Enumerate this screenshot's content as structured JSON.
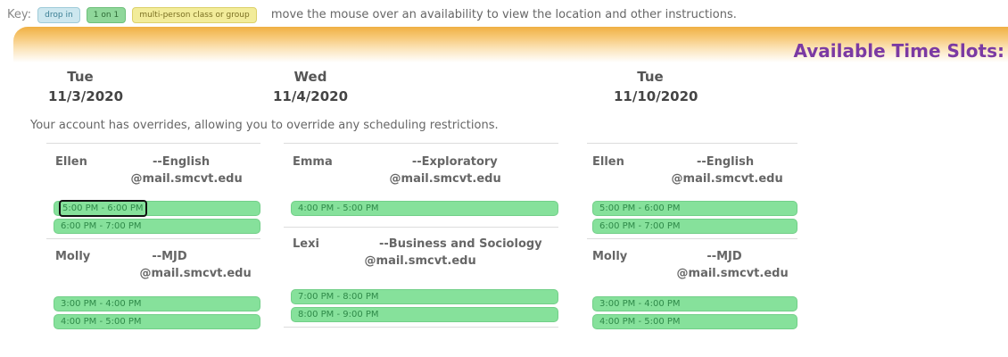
{
  "key": {
    "label": "Key:",
    "chips": [
      "drop in",
      "1 on 1",
      "multi-person class or group"
    ],
    "instruction": "move the mouse over an availability to view the location and other instructions."
  },
  "banner": {
    "title": "Available Time Slots:"
  },
  "days": [
    {
      "dow": "Tue",
      "date": "11/3/2020"
    },
    {
      "dow": "Wed",
      "date": "11/4/2020"
    },
    {
      "dow": "Tue",
      "date": "11/10/2020"
    }
  ],
  "override_notice": "Your account has overrides, allowing you to override any scheduling restrictions.",
  "columns": [
    {
      "tutors": [
        {
          "name": "Ellen",
          "subject": "--English",
          "email": "@mail.smcvt.edu",
          "slots": [
            "5:00 PM - 6:00 PM",
            "6:00 PM - 7:00 PM"
          ]
        },
        {
          "name": "Molly",
          "subject": "--MJD",
          "email": "@mail.smcvt.edu",
          "slots": [
            "3:00 PM - 4:00 PM",
            "4:00 PM - 5:00 PM"
          ]
        }
      ]
    },
    {
      "tutors": [
        {
          "name": "Emma",
          "subject": "--Exploratory",
          "email": "@mail.smcvt.edu",
          "slots": [
            "4:00 PM - 5:00 PM"
          ]
        },
        {
          "name": "Lexi",
          "subject": "--Business and Sociology",
          "email": "@mail.smcvt.edu",
          "slots": [
            "7:00 PM - 8:00 PM",
            "8:00 PM - 9:00 PM"
          ]
        }
      ]
    },
    {
      "tutors": [
        {
          "name": "Ellen",
          "subject": "--English",
          "email": "@mail.smcvt.edu",
          "slots": [
            "5:00 PM - 6:00 PM",
            "6:00 PM - 7:00 PM"
          ]
        },
        {
          "name": "Molly",
          "subject": "--MJD",
          "email": "@mail.smcvt.edu",
          "slots": [
            "3:00 PM - 4:00 PM",
            "4:00 PM - 5:00 PM"
          ]
        }
      ]
    }
  ]
}
